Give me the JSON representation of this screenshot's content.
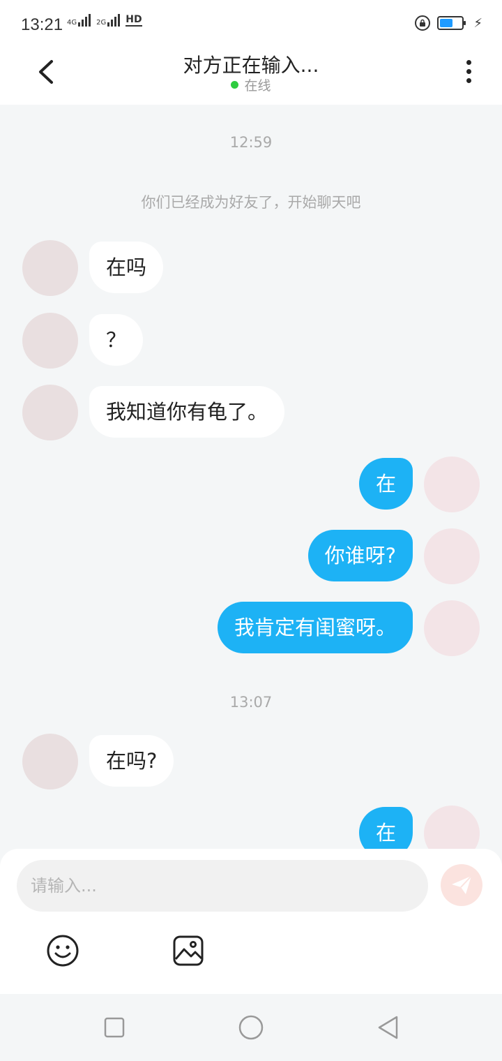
{
  "status_bar": {
    "time": "13:21",
    "net_4g": "4G",
    "net_2g": "2G",
    "hd": "HD",
    "battery_level": 0.58
  },
  "header": {
    "title": "对方正在输入...",
    "presence": "在线",
    "presence_color": "#2ecc40"
  },
  "chat": {
    "timestamps": [
      "12:59",
      "13:07"
    ],
    "system_message": "你们已经成为好友了，开始聊天吧",
    "messages": [
      {
        "side": "left",
        "text": "在吗"
      },
      {
        "side": "left",
        "text": "？"
      },
      {
        "side": "left",
        "text": "我知道你有龟了。"
      },
      {
        "side": "right",
        "text": "在"
      },
      {
        "side": "right",
        "text": "你谁呀?"
      },
      {
        "side": "right",
        "text": "我肯定有闺蜜呀。"
      },
      {
        "side": "left",
        "text": "在吗?"
      },
      {
        "side": "right",
        "text": "在"
      }
    ]
  },
  "input": {
    "placeholder": "请输入..."
  },
  "colors": {
    "outgoing_bubble": "#1db2f5",
    "incoming_bubble": "#ffffff",
    "send_button": "#fbe3df"
  },
  "icons": {
    "back": "chevron-left-icon",
    "more": "more-vertical-icon",
    "send": "paper-plane-icon",
    "emoji": "smiley-icon",
    "image": "image-icon",
    "nav_recent": "square-icon",
    "nav_home": "circle-icon",
    "nav_back": "triangle-back-icon"
  }
}
